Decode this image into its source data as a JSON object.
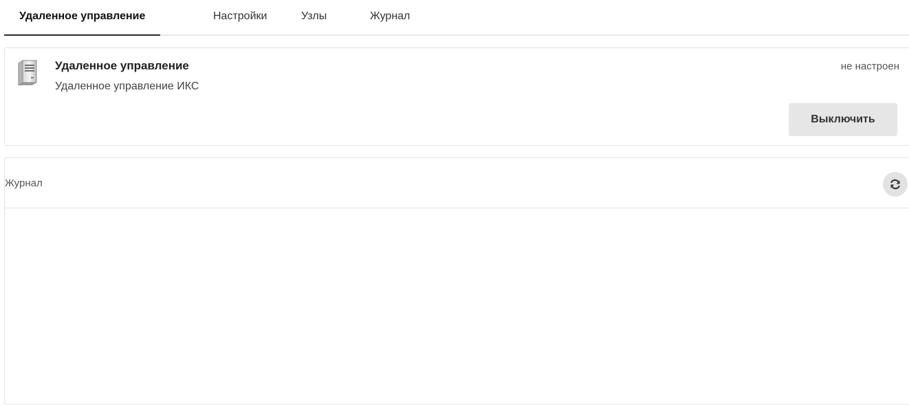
{
  "tabs": [
    {
      "label": "Удаленное управление",
      "active": true
    },
    {
      "label": "Настройки",
      "active": false
    },
    {
      "label": "Узлы",
      "active": false
    },
    {
      "label": "Журнал",
      "active": false
    }
  ],
  "module": {
    "icon": "server-icon",
    "title": "Удаленное управление",
    "subtitle": "Удаленное управление ИКС",
    "status": "не настроен",
    "button_label": "Выключить"
  },
  "log": {
    "title": "Журнал",
    "refresh_icon": "refresh-icon"
  }
}
